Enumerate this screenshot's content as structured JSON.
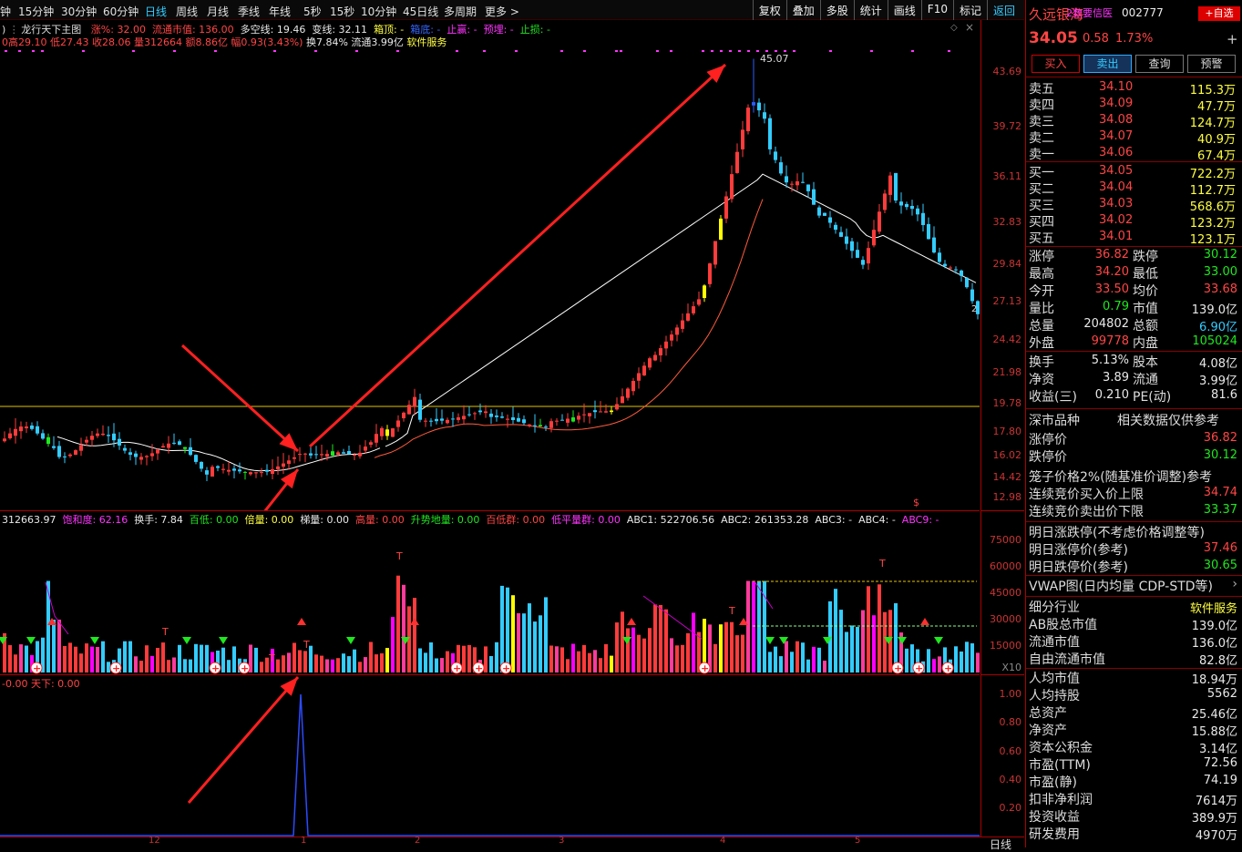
{
  "top": {
    "periods": [
      "钟",
      "15分钟",
      "30分钟",
      "60分钟",
      "日线",
      "周线",
      "月线",
      "季线",
      "年线",
      "5秒",
      "15秒",
      "10分钟",
      "45日线",
      "多周期",
      "更多 >"
    ],
    "active_period": "日线",
    "tools": [
      "复权",
      "叠加",
      "多股",
      "统计",
      "画线",
      "F10",
      "标记",
      "返回"
    ],
    "active_tool": "返回"
  },
  "main": {
    "title": "龙行天下主图",
    "ind1": [
      {
        "t": "涨%: 32.00",
        "c": "red"
      },
      {
        "t": "流通市值: 136.00",
        "c": "red"
      },
      {
        "t": "多空线: 19.46",
        "c": "wht"
      },
      {
        "t": "变线: 32.11",
        "c": "wht"
      },
      {
        "t": "箱顶: -",
        "c": "yel"
      },
      {
        "t": "箱底: -",
        "c": "blu"
      },
      {
        "t": "止赢: -",
        "c": "mag"
      },
      {
        "t": "预埋: -",
        "c": "mag"
      },
      {
        "t": "止损: -",
        "c": "grn"
      }
    ],
    "ohlc": "0高29.10 低27.43 收28.06 量312664 额8.86亿 幅0.93(3.43%)",
    "ohlc2": "换7.84% 流通3.99亿",
    "service": "软件服务",
    "left_tag": ")",
    "peak_label": "45.07",
    "right_mark": "2",
    "prices": [
      "43.69",
      "39.72",
      "36.11",
      "32.83",
      "29.84",
      "27.13",
      "24.42",
      "21.98",
      "19.78",
      "17.80",
      "16.02",
      "14.42",
      "12.98"
    ]
  },
  "vol": {
    "ind": [
      {
        "t": "312663.97",
        "c": "wht"
      },
      {
        "t": "饱和度: 62.16",
        "c": "mag"
      },
      {
        "t": "换手: 7.84",
        "c": "wht"
      },
      {
        "t": "百低: 0.00",
        "c": "grn"
      },
      {
        "t": "倍量: 0.00",
        "c": "yel"
      },
      {
        "t": "梯量: 0.00",
        "c": "wht"
      },
      {
        "t": "高量: 0.00",
        "c": "red"
      },
      {
        "t": "升势地量: 0.00",
        "c": "grn"
      },
      {
        "t": "百低群: 0.00",
        "c": "red"
      },
      {
        "t": "低平量群: 0.00",
        "c": "mag"
      },
      {
        "t": "ABC1: 522706.56",
        "c": "wht"
      },
      {
        "t": "ABC2: 261353.28",
        "c": "wht"
      },
      {
        "t": "ABC3: -",
        "c": "wht"
      },
      {
        "t": "ABC4: -",
        "c": "wht"
      },
      {
        "t": "ABC9: -",
        "c": "mag"
      }
    ],
    "axis": [
      "75000",
      "60000",
      "45000",
      "30000",
      "15000",
      "X10"
    ]
  },
  "sub": {
    "ind": "-0.00 天下: 0.00",
    "axis": [
      "1.00",
      "0.80",
      "0.60",
      "0.40",
      "0.20"
    ],
    "date_labels": [
      "12",
      "1",
      "2",
      "3",
      "4",
      "5"
    ],
    "right_tab": "日线"
  },
  "quote": {
    "name": "久远银海",
    "tag": "2数要信医",
    "code": "002777",
    "fav": "+自选",
    "price": "34.05",
    "chg": "0.58",
    "pct": "1.73%",
    "buttons": [
      "买入",
      "卖出",
      "查询",
      "预警"
    ],
    "asks": [
      {
        "l": "卖五",
        "p": "34.10",
        "v": "115.3万"
      },
      {
        "l": "卖四",
        "p": "34.09",
        "v": "47.7万"
      },
      {
        "l": "卖三",
        "p": "34.08",
        "v": "124.7万"
      },
      {
        "l": "卖二",
        "p": "34.07",
        "v": "40.9万"
      },
      {
        "l": "卖一",
        "p": "34.06",
        "v": "67.4万"
      }
    ],
    "bids": [
      {
        "l": "买一",
        "p": "34.05",
        "v": "722.2万"
      },
      {
        "l": "买二",
        "p": "34.04",
        "v": "112.7万"
      },
      {
        "l": "买三",
        "p": "34.03",
        "v": "568.6万"
      },
      {
        "l": "买四",
        "p": "34.02",
        "v": "123.2万"
      },
      {
        "l": "买五",
        "p": "34.01",
        "v": "123.1万"
      }
    ],
    "stats": [
      [
        "涨停",
        "36.82",
        "跌停",
        "30.12"
      ],
      [
        "最高",
        "34.20",
        "最低",
        "33.00"
      ],
      [
        "今开",
        "33.50",
        "均价",
        "33.68"
      ],
      [
        "量比",
        "0.79",
        "市值",
        "139.0亿"
      ],
      [
        "总量",
        "204802",
        "总额",
        "6.90亿"
      ],
      [
        "外盘",
        "99778",
        "内盘",
        "105024"
      ]
    ],
    "stats2": [
      [
        "换手",
        "5.13%",
        "股本",
        "4.08亿"
      ],
      [
        "净资",
        "3.89",
        "流通",
        "3.99亿"
      ],
      [
        "收益(三)",
        "0.210",
        "PE(动)",
        "81.6"
      ]
    ],
    "market": "深市品种",
    "ref": "相关数据仅供参考",
    "limits": [
      [
        "涨停价",
        "36.82"
      ],
      [
        "跌停价",
        "30.12"
      ]
    ],
    "cage": "笼子价格2%(随基准价调整)参考",
    "auction": [
      [
        "连续竞价买入价上限",
        "34.74"
      ],
      [
        "连续竞价卖出价下限",
        "33.37"
      ]
    ],
    "next": "明日涨跌停(不考虑价格调整等)",
    "next_up": [
      "明日涨停价(参考)",
      "37.46"
    ],
    "next_dn": [
      "明日跌停价(参考)",
      "30.65"
    ],
    "vwap": "VWAP图(日内均量 CDP-STD等)",
    "industry": [
      "细分行业",
      "软件服务"
    ],
    "fund": [
      [
        "AB股总市值",
        "139.0亿"
      ],
      [
        "流通市值",
        "136.0亿"
      ],
      [
        "自由流通市值",
        "82.8亿"
      ],
      [
        "人均市值",
        "18.94万"
      ],
      [
        "人均持股",
        "5562"
      ],
      [
        "总资产",
        "25.46亿"
      ],
      [
        "净资产",
        "15.88亿"
      ],
      [
        "资本公积金",
        "3.14亿"
      ],
      [
        "市盈(TTM)",
        "72.56"
      ],
      [
        "市盈(静)",
        "74.19"
      ],
      [
        "扣非净利润",
        "7614万"
      ],
      [
        "投资收益",
        "389.9万"
      ],
      [
        "研发费用",
        "4970万"
      ]
    ]
  },
  "colors": {
    "up": "#ff3b3b",
    "down": "#3cf",
    "ma": "#ff5a3c",
    "ma2": "#ffffff"
  }
}
